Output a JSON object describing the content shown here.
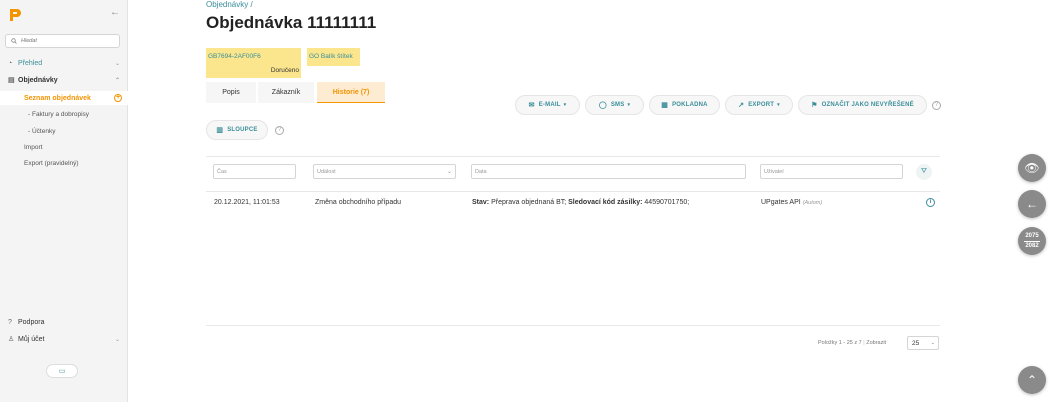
{
  "sidebar": {
    "search_placeholder": "Hledat",
    "items": [
      {
        "label": "Přehled"
      },
      {
        "label": "Objednávky"
      },
      {
        "label": "Seznam objednávek"
      },
      {
        "label": "- Faktury a dobropisy"
      },
      {
        "label": "- Účtenky"
      },
      {
        "label": "Import"
      },
      {
        "label": "Export (pravidelný)"
      }
    ],
    "support": "Podpora",
    "account": "Můj účet"
  },
  "breadcrumb": "Objednávky /",
  "title": "Objednávka 11111111",
  "tags": {
    "tracking_code": "GB7694-2AF00F6",
    "tracking_status": "Doručeno",
    "label": "GO Balík štítek"
  },
  "tabs": [
    {
      "label": "Popis"
    },
    {
      "label": "Zákazník"
    },
    {
      "label": "Historie (7)"
    }
  ],
  "actions": {
    "email": "E-MAIL",
    "sms": "SMS",
    "register": "POKLADNA",
    "export": "EXPORT",
    "mark_unresolved": "OZNAČIT JAKO NEVYŘEŠENÉ",
    "columns": "SLOUPCE"
  },
  "filters": {
    "time": "Čas",
    "event": "Událost",
    "data": "Data",
    "user": "Uživatel"
  },
  "rows": [
    {
      "time": "20.12.2021, 11:01:53",
      "event": "Změna obchodního případu",
      "data_k1": "Stav:",
      "data_v1": "Přeprava objednaná BT;",
      "data_k2": "Sledovací kód zásilky:",
      "data_v2": "44590701750;",
      "user": "UPgates API",
      "user_note": "(Autom)"
    }
  ],
  "pagination": {
    "summary": "Položky 1 - 25 z 7",
    "show_label": "Zobrazit",
    "page_size": "25"
  },
  "zoom": {
    "top": "2075",
    "bottom": "2082"
  },
  "colors": {
    "accent": "#f39400",
    "link": "#3a8e9a",
    "tag_bg": "#fbe68d"
  }
}
